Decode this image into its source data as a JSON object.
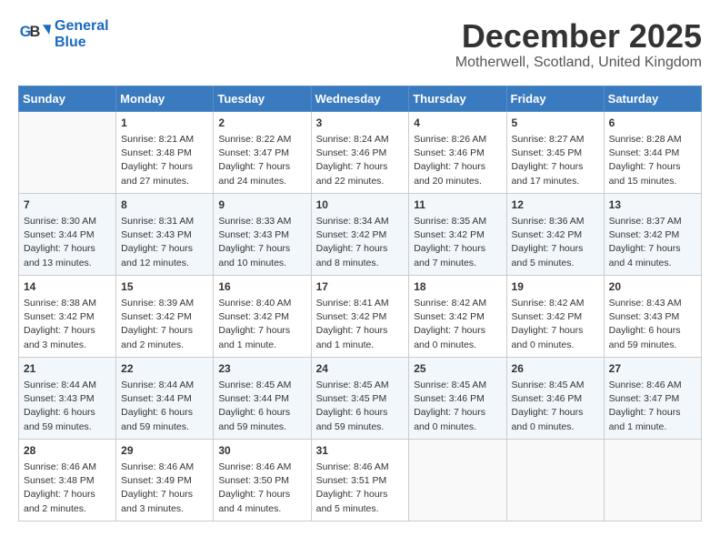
{
  "header": {
    "logo_line1": "General",
    "logo_line2": "Blue",
    "month": "December 2025",
    "location": "Motherwell, Scotland, United Kingdom"
  },
  "weekdays": [
    "Sunday",
    "Monday",
    "Tuesday",
    "Wednesday",
    "Thursday",
    "Friday",
    "Saturday"
  ],
  "weeks": [
    [
      {
        "day": "",
        "empty": true
      },
      {
        "day": "1",
        "sunrise": "8:21 AM",
        "sunset": "3:48 PM",
        "daylight": "7 hours and 27 minutes."
      },
      {
        "day": "2",
        "sunrise": "8:22 AM",
        "sunset": "3:47 PM",
        "daylight": "7 hours and 24 minutes."
      },
      {
        "day": "3",
        "sunrise": "8:24 AM",
        "sunset": "3:46 PM",
        "daylight": "7 hours and 22 minutes."
      },
      {
        "day": "4",
        "sunrise": "8:26 AM",
        "sunset": "3:46 PM",
        "daylight": "7 hours and 20 minutes."
      },
      {
        "day": "5",
        "sunrise": "8:27 AM",
        "sunset": "3:45 PM",
        "daylight": "7 hours and 17 minutes."
      },
      {
        "day": "6",
        "sunrise": "8:28 AM",
        "sunset": "3:44 PM",
        "daylight": "7 hours and 15 minutes."
      }
    ],
    [
      {
        "day": "7",
        "sunrise": "8:30 AM",
        "sunset": "3:44 PM",
        "daylight": "7 hours and 13 minutes."
      },
      {
        "day": "8",
        "sunrise": "8:31 AM",
        "sunset": "3:43 PM",
        "daylight": "7 hours and 12 minutes."
      },
      {
        "day": "9",
        "sunrise": "8:33 AM",
        "sunset": "3:43 PM",
        "daylight": "7 hours and 10 minutes."
      },
      {
        "day": "10",
        "sunrise": "8:34 AM",
        "sunset": "3:42 PM",
        "daylight": "7 hours and 8 minutes."
      },
      {
        "day": "11",
        "sunrise": "8:35 AM",
        "sunset": "3:42 PM",
        "daylight": "7 hours and 7 minutes."
      },
      {
        "day": "12",
        "sunrise": "8:36 AM",
        "sunset": "3:42 PM",
        "daylight": "7 hours and 5 minutes."
      },
      {
        "day": "13",
        "sunrise": "8:37 AM",
        "sunset": "3:42 PM",
        "daylight": "7 hours and 4 minutes."
      }
    ],
    [
      {
        "day": "14",
        "sunrise": "8:38 AM",
        "sunset": "3:42 PM",
        "daylight": "7 hours and 3 minutes."
      },
      {
        "day": "15",
        "sunrise": "8:39 AM",
        "sunset": "3:42 PM",
        "daylight": "7 hours and 2 minutes."
      },
      {
        "day": "16",
        "sunrise": "8:40 AM",
        "sunset": "3:42 PM",
        "daylight": "7 hours and 1 minute."
      },
      {
        "day": "17",
        "sunrise": "8:41 AM",
        "sunset": "3:42 PM",
        "daylight": "7 hours and 1 minute."
      },
      {
        "day": "18",
        "sunrise": "8:42 AM",
        "sunset": "3:42 PM",
        "daylight": "7 hours and 0 minutes."
      },
      {
        "day": "19",
        "sunrise": "8:42 AM",
        "sunset": "3:42 PM",
        "daylight": "7 hours and 0 minutes."
      },
      {
        "day": "20",
        "sunrise": "8:43 AM",
        "sunset": "3:43 PM",
        "daylight": "6 hours and 59 minutes."
      }
    ],
    [
      {
        "day": "21",
        "sunrise": "8:44 AM",
        "sunset": "3:43 PM",
        "daylight": "6 hours and 59 minutes."
      },
      {
        "day": "22",
        "sunrise": "8:44 AM",
        "sunset": "3:44 PM",
        "daylight": "6 hours and 59 minutes."
      },
      {
        "day": "23",
        "sunrise": "8:45 AM",
        "sunset": "3:44 PM",
        "daylight": "6 hours and 59 minutes."
      },
      {
        "day": "24",
        "sunrise": "8:45 AM",
        "sunset": "3:45 PM",
        "daylight": "6 hours and 59 minutes."
      },
      {
        "day": "25",
        "sunrise": "8:45 AM",
        "sunset": "3:46 PM",
        "daylight": "7 hours and 0 minutes."
      },
      {
        "day": "26",
        "sunrise": "8:45 AM",
        "sunset": "3:46 PM",
        "daylight": "7 hours and 0 minutes."
      },
      {
        "day": "27",
        "sunrise": "8:46 AM",
        "sunset": "3:47 PM",
        "daylight": "7 hours and 1 minute."
      }
    ],
    [
      {
        "day": "28",
        "sunrise": "8:46 AM",
        "sunset": "3:48 PM",
        "daylight": "7 hours and 2 minutes."
      },
      {
        "day": "29",
        "sunrise": "8:46 AM",
        "sunset": "3:49 PM",
        "daylight": "7 hours and 3 minutes."
      },
      {
        "day": "30",
        "sunrise": "8:46 AM",
        "sunset": "3:50 PM",
        "daylight": "7 hours and 4 minutes."
      },
      {
        "day": "31",
        "sunrise": "8:46 AM",
        "sunset": "3:51 PM",
        "daylight": "7 hours and 5 minutes."
      },
      {
        "day": "",
        "empty": true
      },
      {
        "day": "",
        "empty": true
      },
      {
        "day": "",
        "empty": true
      }
    ]
  ]
}
